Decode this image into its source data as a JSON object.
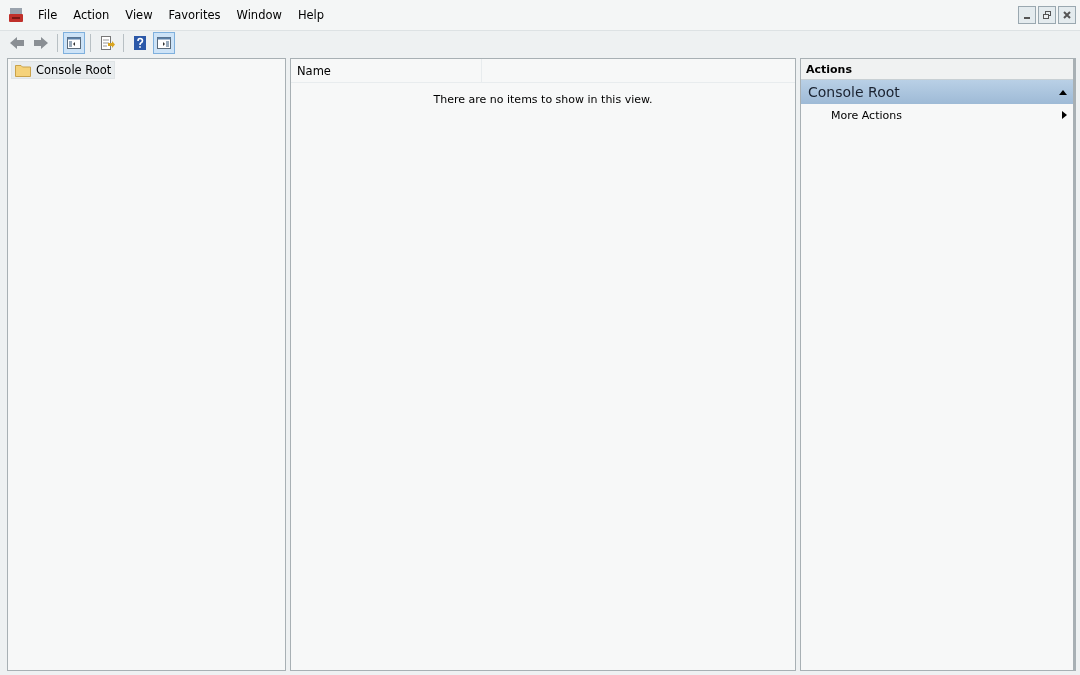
{
  "menu": [
    "File",
    "Action",
    "View",
    "Favorites",
    "Window",
    "Help"
  ],
  "toolbar": [
    {
      "kind": "back",
      "selected": false
    },
    {
      "kind": "forward",
      "selected": false
    },
    {
      "kind": "tree",
      "selected": true
    },
    {
      "kind": "export",
      "selected": false
    },
    {
      "kind": "help",
      "selected": false
    },
    {
      "kind": "actionpane",
      "selected": true
    }
  ],
  "tree": {
    "items": [
      {
        "label": "Console Root",
        "selected": true
      }
    ]
  },
  "list": {
    "columns": [
      "Name"
    ],
    "empty_message": "There are no items to show in this view."
  },
  "actions": {
    "title": "Actions",
    "sections": [
      {
        "label": "Console Root",
        "expanded": true,
        "items": [
          "More Actions"
        ]
      }
    ]
  }
}
